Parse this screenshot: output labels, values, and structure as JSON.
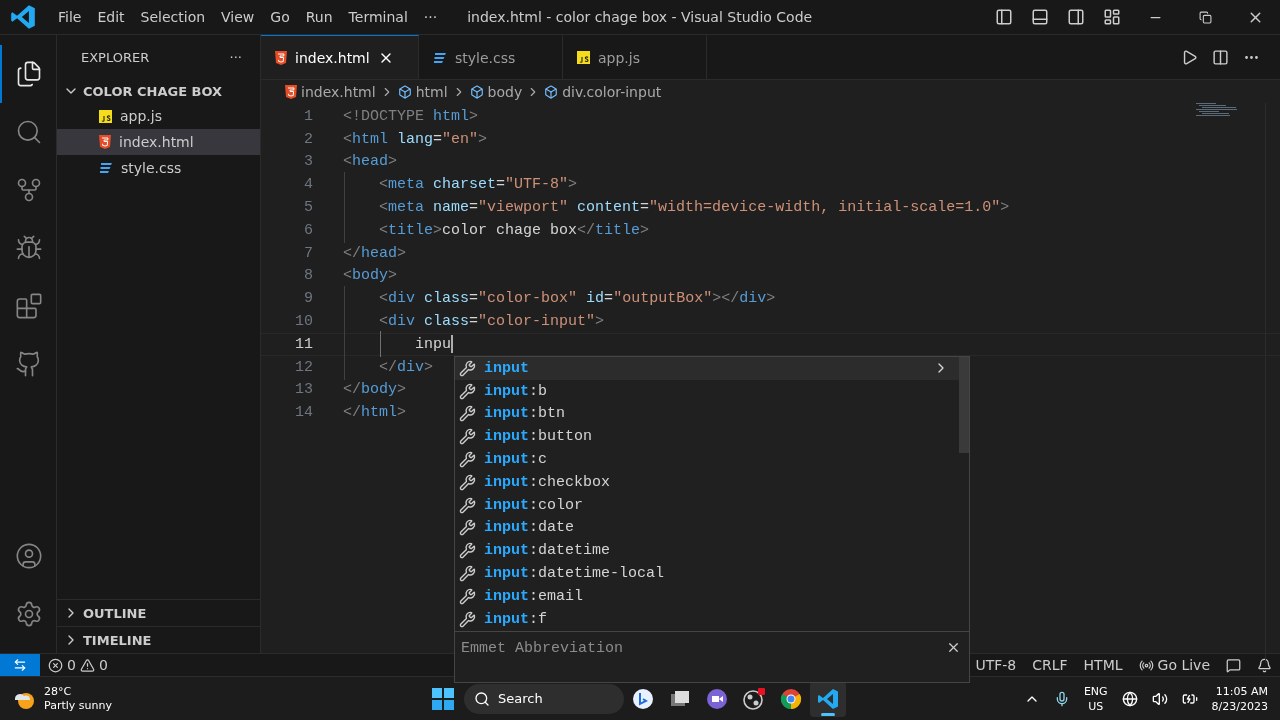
{
  "title_bar": {
    "menus": [
      "File",
      "Edit",
      "Selection",
      "View",
      "Go",
      "Run",
      "Terminal",
      "···"
    ],
    "title": "index.html - color chage box - Visual Studio Code"
  },
  "activity_bar": [
    {
      "kind": "explorer",
      "selected": true
    },
    {
      "kind": "search",
      "selected": false
    },
    {
      "kind": "source-control",
      "selected": false
    },
    {
      "kind": "debug",
      "selected": false
    },
    {
      "kind": "extensions",
      "selected": false
    },
    {
      "kind": "github",
      "selected": false
    },
    {
      "kind": "account",
      "selected": false
    },
    {
      "kind": "settings",
      "selected": false
    }
  ],
  "sidebar": {
    "title": "EXPLORER",
    "more": "···",
    "folder": {
      "name": "COLOR CHAGE BOX",
      "expanded": true,
      "files": [
        {
          "name": "app.js",
          "kind": "js",
          "selected": false
        },
        {
          "name": "index.html",
          "kind": "html",
          "selected": true
        },
        {
          "name": "style.css",
          "kind": "css",
          "selected": false
        }
      ]
    },
    "sections": [
      {
        "name": "OUTLINE",
        "expanded": false
      },
      {
        "name": "TIMELINE",
        "expanded": false
      }
    ]
  },
  "tabs": [
    {
      "name": "index.html",
      "kind": "html",
      "selected": true
    },
    {
      "name": "style.css",
      "kind": "css",
      "selected": false
    },
    {
      "name": "app.js",
      "kind": "js",
      "selected": false
    }
  ],
  "breadcrumb": [
    {
      "label": "index.html",
      "kind": "file"
    },
    {
      "label": "html",
      "kind": "element"
    },
    {
      "label": "body",
      "kind": "element"
    },
    {
      "label": "div.color-input",
      "kind": "element"
    }
  ],
  "editor": {
    "lines": [
      {
        "number": "1",
        "current": false,
        "tokens": [
          {
            "kind": "punct",
            "text": "<!DOCTYPE "
          },
          {
            "kind": "tag",
            "text": "html"
          },
          {
            "kind": "punct",
            "text": ">"
          }
        ]
      },
      {
        "number": "2",
        "current": false,
        "tokens": [
          {
            "kind": "punct",
            "text": "<"
          },
          {
            "kind": "tag",
            "text": "html"
          },
          {
            "kind": "attr",
            "text": " lang"
          },
          {
            "kind": "plain",
            "text": "="
          },
          {
            "kind": "string",
            "text": "\"en\""
          },
          {
            "kind": "punct",
            "text": ">"
          }
        ]
      },
      {
        "number": "3",
        "current": false,
        "tokens": [
          {
            "kind": "punct",
            "text": "<"
          },
          {
            "kind": "tag",
            "text": "head"
          },
          {
            "kind": "punct",
            "text": ">"
          }
        ]
      },
      {
        "number": "4",
        "current": false,
        "tokens": [
          {
            "kind": "punct",
            "text": "    <"
          },
          {
            "kind": "tag",
            "text": "meta"
          },
          {
            "kind": "attr",
            "text": " charset"
          },
          {
            "kind": "plain",
            "text": "="
          },
          {
            "kind": "string",
            "text": "\"UTF-8\""
          },
          {
            "kind": "punct",
            "text": ">"
          }
        ]
      },
      {
        "number": "5",
        "current": false,
        "tokens": [
          {
            "kind": "punct",
            "text": "    <"
          },
          {
            "kind": "tag",
            "text": "meta"
          },
          {
            "kind": "attr",
            "text": " name"
          },
          {
            "kind": "plain",
            "text": "="
          },
          {
            "kind": "string",
            "text": "\"viewport\""
          },
          {
            "kind": "attr",
            "text": " content"
          },
          {
            "kind": "plain",
            "text": "="
          },
          {
            "kind": "string",
            "text": "\"width=device-width, initial-scale=1.0\""
          },
          {
            "kind": "punct",
            "text": ">"
          }
        ]
      },
      {
        "number": "6",
        "current": false,
        "tokens": [
          {
            "kind": "punct",
            "text": "    <"
          },
          {
            "kind": "tag",
            "text": "title"
          },
          {
            "kind": "punct",
            "text": ">"
          },
          {
            "kind": "plain",
            "text": "color chage box"
          },
          {
            "kind": "punct",
            "text": "</"
          },
          {
            "kind": "tag",
            "text": "title"
          },
          {
            "kind": "punct",
            "text": ">"
          }
        ]
      },
      {
        "number": "7",
        "current": false,
        "tokens": [
          {
            "kind": "punct",
            "text": "</"
          },
          {
            "kind": "tag",
            "text": "head"
          },
          {
            "kind": "punct",
            "text": ">"
          }
        ]
      },
      {
        "number": "8",
        "current": false,
        "tokens": [
          {
            "kind": "punct",
            "text": "<"
          },
          {
            "kind": "tag",
            "text": "body"
          },
          {
            "kind": "punct",
            "text": ">"
          }
        ]
      },
      {
        "number": "9",
        "current": false,
        "tokens": [
          {
            "kind": "punct",
            "text": "    <"
          },
          {
            "kind": "tag",
            "text": "div"
          },
          {
            "kind": "attr",
            "text": " class"
          },
          {
            "kind": "plain",
            "text": "="
          },
          {
            "kind": "string",
            "text": "\"color-box\""
          },
          {
            "kind": "attr",
            "text": " id"
          },
          {
            "kind": "plain",
            "text": "="
          },
          {
            "kind": "string",
            "text": "\"outputBox\""
          },
          {
            "kind": "punct",
            "text": "></"
          },
          {
            "kind": "tag",
            "text": "div"
          },
          {
            "kind": "punct",
            "text": ">"
          }
        ]
      },
      {
        "number": "10",
        "current": false,
        "tokens": [
          {
            "kind": "punct",
            "text": "    <"
          },
          {
            "kind": "tag",
            "text": "div"
          },
          {
            "kind": "attr",
            "text": " class"
          },
          {
            "kind": "plain",
            "text": "="
          },
          {
            "kind": "string",
            "text": "\"color-input\""
          },
          {
            "kind": "punct",
            "text": ">"
          }
        ]
      },
      {
        "number": "11",
        "current": true,
        "tokens": [
          {
            "kind": "plain",
            "text": "        inpu"
          }
        ]
      },
      {
        "number": "12",
        "current": false,
        "tokens": [
          {
            "kind": "punct",
            "text": "    </"
          },
          {
            "kind": "tag",
            "text": "div"
          },
          {
            "kind": "punct",
            "text": ">"
          }
        ]
      },
      {
        "number": "13",
        "current": false,
        "tokens": [
          {
            "kind": "punct",
            "text": "</"
          },
          {
            "kind": "tag",
            "text": "body"
          },
          {
            "kind": "punct",
            "text": ">"
          }
        ]
      },
      {
        "number": "14",
        "current": false,
        "tokens": [
          {
            "kind": "punct",
            "text": "</"
          },
          {
            "kind": "tag",
            "text": "html"
          },
          {
            "kind": "punct",
            "text": ">"
          }
        ]
      }
    ]
  },
  "suggestions": {
    "items": [
      {
        "match": "input",
        "selected": true
      },
      {
        "match": "input",
        "rest": ":b",
        "selected": false
      },
      {
        "match": "input",
        "rest": ":btn",
        "selected": false
      },
      {
        "match": "input",
        "rest": ":button",
        "selected": false
      },
      {
        "match": "input",
        "rest": ":c",
        "selected": false
      },
      {
        "match": "input",
        "rest": ":checkbox",
        "selected": false
      },
      {
        "match": "input",
        "rest": ":color",
        "selected": false
      },
      {
        "match": "input",
        "rest": ":date",
        "selected": false
      },
      {
        "match": "input",
        "rest": ":datetime",
        "selected": false
      },
      {
        "match": "input",
        "rest": ":datetime-local",
        "selected": false
      },
      {
        "match": "input",
        "rest": ":email",
        "selected": false
      },
      {
        "match": "input",
        "rest": ":f",
        "selected": false
      }
    ],
    "detail": "Emmet Abbreviation"
  },
  "status_bar": {
    "errors": "0",
    "warnings": "0",
    "right": [
      {
        "kind": "text",
        "label": "UTF-8"
      },
      {
        "kind": "text",
        "label": "CRLF"
      },
      {
        "kind": "text",
        "label": "HTML"
      },
      {
        "kind": "golive",
        "label": "Go Live"
      },
      {
        "kind": "feedback"
      },
      {
        "kind": "bell"
      }
    ]
  },
  "taskbar": {
    "weather": {
      "temp": "28°C",
      "desc": "Partly sunny"
    },
    "search": "Search",
    "apps": [
      {
        "kind": "bing",
        "active": false
      },
      {
        "kind": "files",
        "active": false
      },
      {
        "kind": "chat",
        "active": false
      },
      {
        "kind": "obs",
        "active": false
      },
      {
        "kind": "chrome",
        "active": false
      },
      {
        "kind": "vscode",
        "active": true
      }
    ],
    "tray": {
      "lang": "ENG",
      "region": "US",
      "time": "11:05 AM",
      "date": "8/23/2023"
    }
  }
}
